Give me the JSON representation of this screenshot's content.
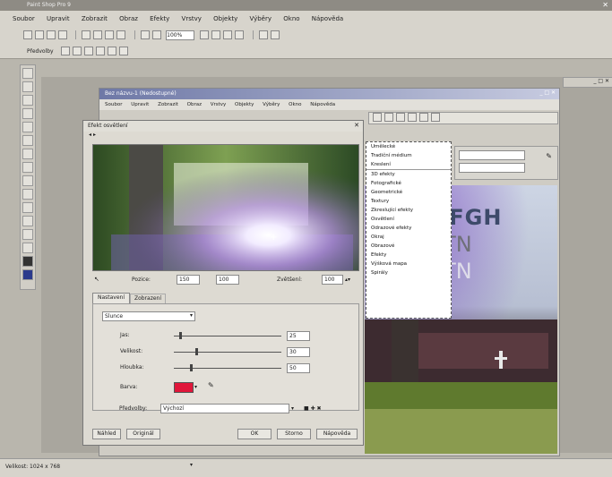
{
  "app": {
    "title": "Paint Shop Pro 9"
  },
  "menubar": [
    "Soubor",
    "Upravit",
    "Zobrazit",
    "Obraz",
    "Efekty",
    "Vrstvy",
    "Objekty",
    "Výběry",
    "Okno",
    "Nápověda"
  ],
  "toolbar": {
    "zoom": "100%"
  },
  "toolbar2": {
    "label": "Předvolby"
  },
  "document": {
    "title": "Bez názvu-1 (Nedostupné)",
    "menu": [
      "Soubor",
      "Upravit",
      "Zobrazit",
      "Obraz",
      "Vrstvy",
      "Objekty",
      "Výběry",
      "Okno",
      "Nápověda"
    ],
    "overlay_text": [
      "BCDEFGH",
      "SCRDTN",
      "SCRDTN"
    ]
  },
  "dialog": {
    "title": "Efekt osvětlení",
    "tabs": [
      "Nastavení",
      "Zobrazení"
    ],
    "position": {
      "x_label": "Pozice:",
      "x": "150",
      "y": "100",
      "zoom_label": "Zvětšení:",
      "zoom": "100"
    },
    "preset": "Slunce",
    "sliders": [
      {
        "label": "Jas:",
        "value": "25",
        "fill": 0.05
      },
      {
        "label": "Velikost:",
        "value": "30",
        "fill": 0.2
      },
      {
        "label": "Hloubka:",
        "value": "50",
        "fill": 0.15
      }
    ],
    "color_label": "Barva:",
    "color": "#e0163a",
    "footer_label": "Předvolby:",
    "footer_value": "Výchozí",
    "buttons": {
      "reset": "Náhled",
      "preview": "Originál",
      "ok": "OK",
      "cancel": "Storno",
      "help": "Nápověda"
    }
  },
  "context_menu": [
    "Umělecké",
    "Tradiční médium",
    "Kreslení",
    "3D efekty",
    "Fotografické",
    "Geometrické",
    "Textury",
    "Zkreslující efekty",
    "Osvětlení",
    "Odrazové efekty",
    "Okraj",
    "Obrazové",
    "Efekty",
    "Výšková mapa",
    "Spirály"
  ],
  "statusbar": {
    "text": "Velikost: 1024 x 768"
  }
}
